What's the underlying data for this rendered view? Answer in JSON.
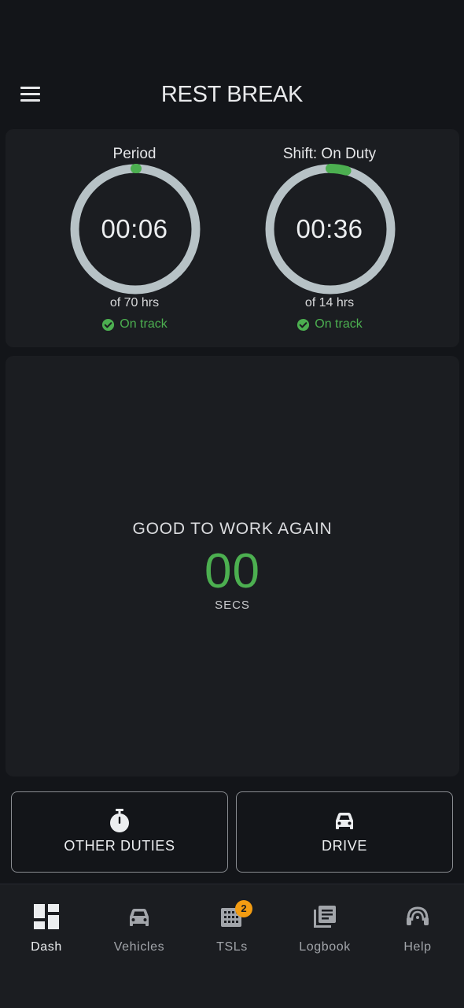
{
  "header": {
    "title": "REST BREAK",
    "menu_icon": "hamburger-menu-icon"
  },
  "timers": [
    {
      "label": "Period",
      "value": "00:06",
      "subtitle": "of 70 hrs",
      "status": "On track",
      "progress": 0.0014
    },
    {
      "label": "Shift: On Duty",
      "value": "00:36",
      "subtitle": "of 14 hrs",
      "status": "On track",
      "progress": 0.043
    }
  ],
  "break_status": {
    "label": "GOOD TO WORK AGAIN",
    "value": "00",
    "unit": "SECS"
  },
  "actions": {
    "other_duties_label": "OTHER DUTIES",
    "drive_label": "DRIVE"
  },
  "bottom_nav": {
    "items": [
      {
        "label": "Dash",
        "icon": "dashboard-icon",
        "active": true
      },
      {
        "label": "Vehicles",
        "icon": "car-icon",
        "active": false
      },
      {
        "label": "TSLs",
        "icon": "building-icon",
        "active": false,
        "badge": "2"
      },
      {
        "label": "Logbook",
        "icon": "logbook-icon",
        "active": false
      },
      {
        "label": "Help",
        "icon": "headset-icon",
        "active": false
      }
    ]
  },
  "colors": {
    "background": "#131519",
    "card": "#1b1d21",
    "accent_green": "#4caf50",
    "gauge_track": "#b7c2c6",
    "badge": "#f39c12"
  }
}
